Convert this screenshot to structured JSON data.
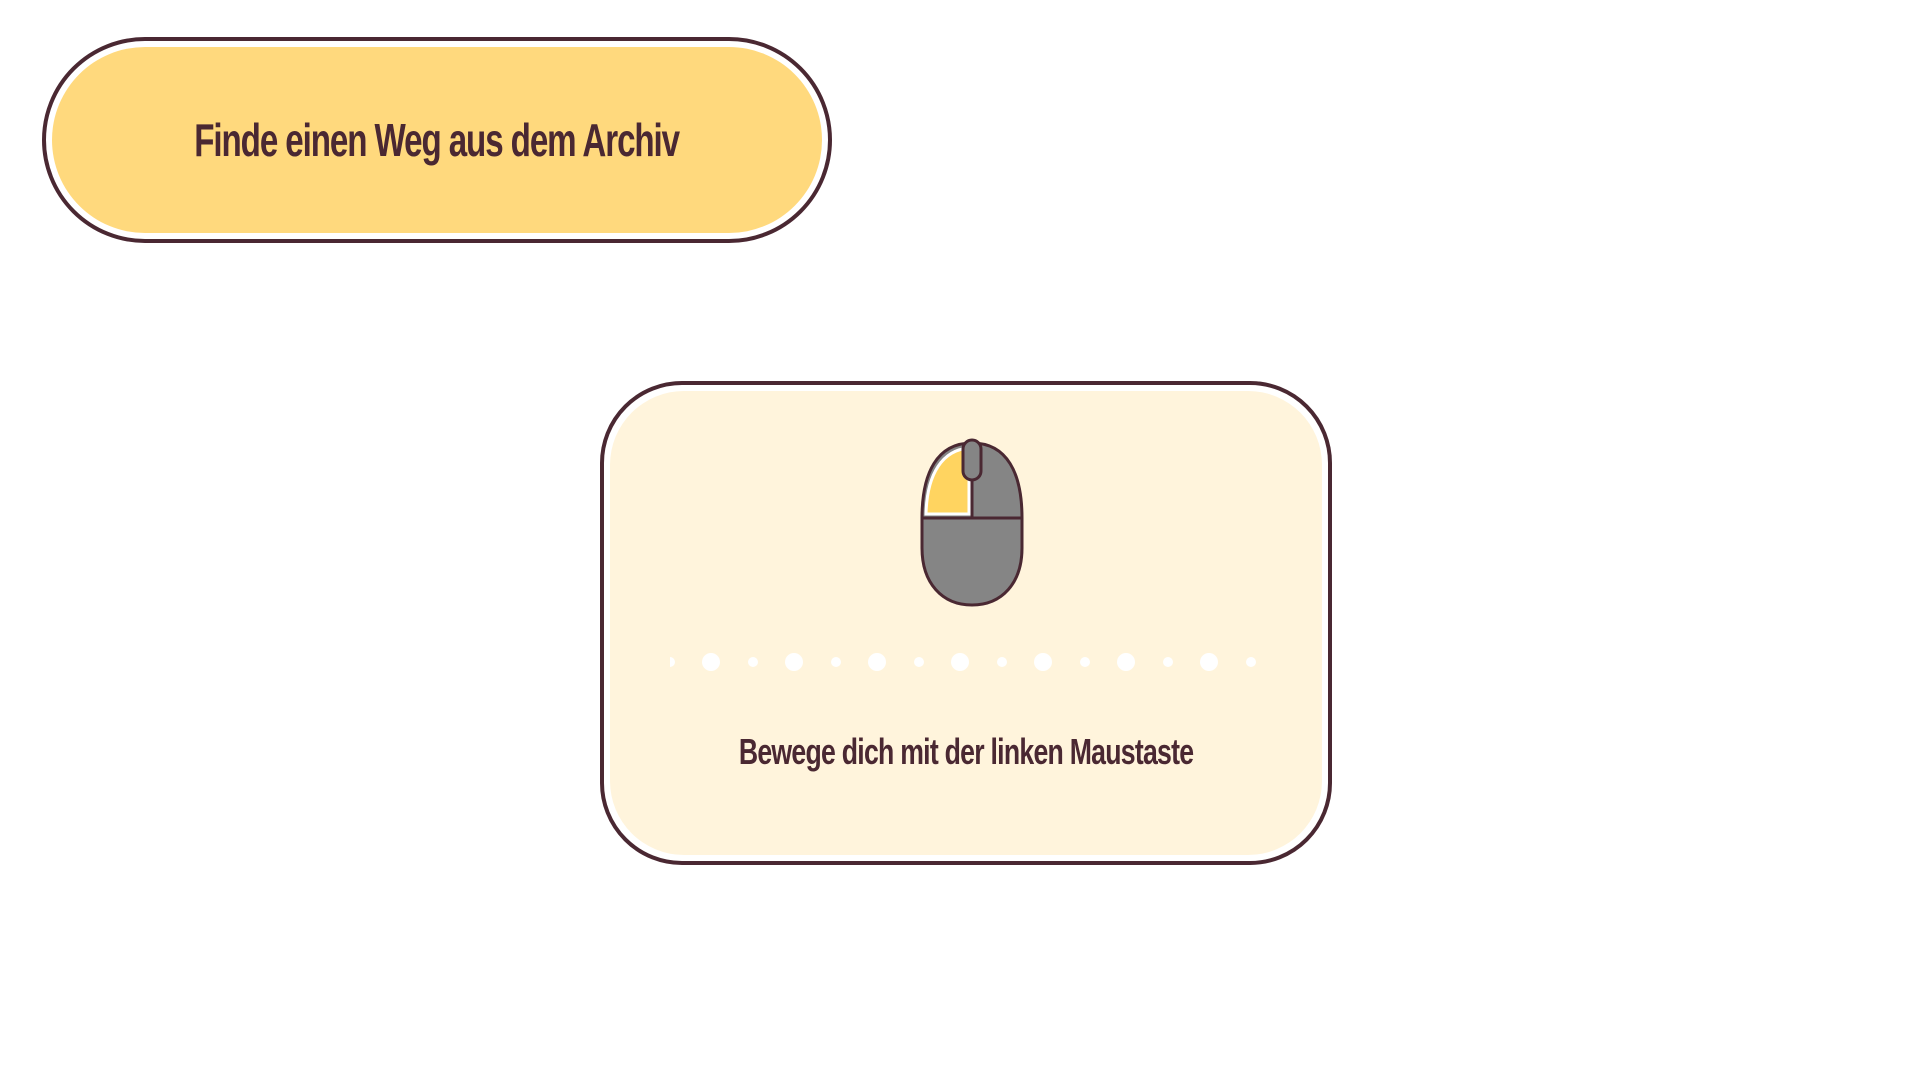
{
  "objective": {
    "title": "Finde einen Weg aus dem Archiv"
  },
  "tutorial": {
    "icon": "mouse-left-click-icon",
    "hint": "Bewege dich mit der linken Maustaste"
  },
  "colors": {
    "outline": "#4a2832",
    "pill_fill": "#ffd97d",
    "card_fill": "#fff4dc",
    "mouse_body": "#858585",
    "mouse_left_button": "#ffd460",
    "dots": "#ffffff"
  }
}
